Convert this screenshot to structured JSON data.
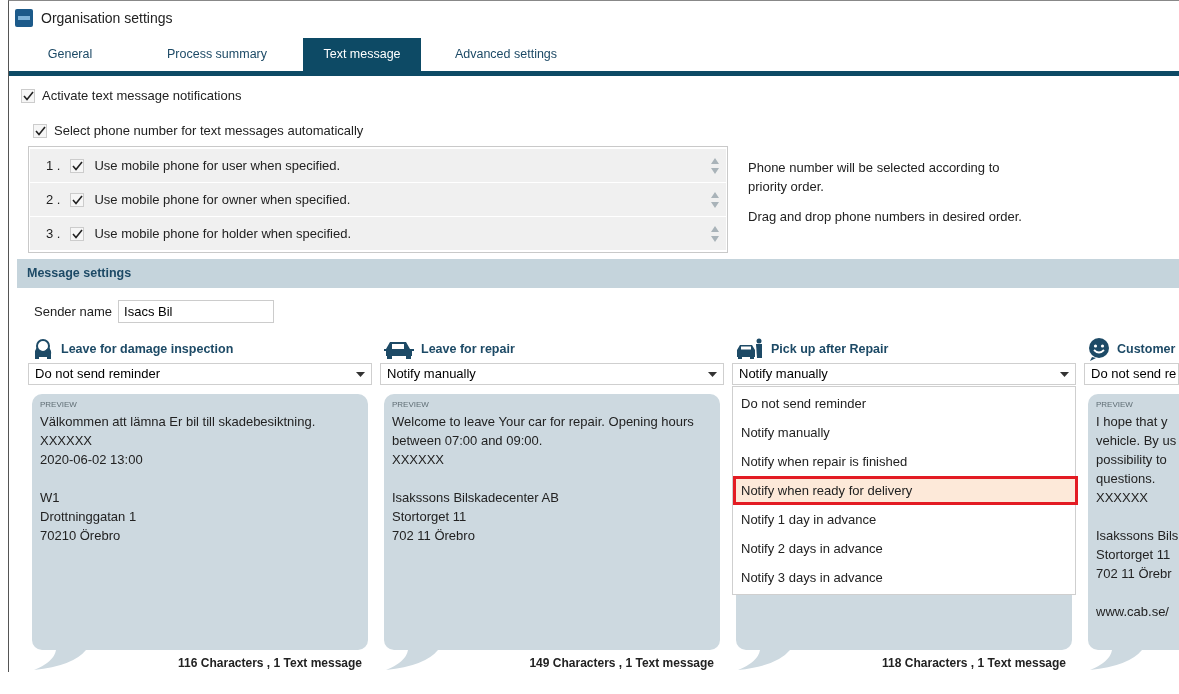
{
  "window": {
    "title": "Organisation settings"
  },
  "tabs": [
    {
      "label": "General",
      "selected": false
    },
    {
      "label": "Process summary",
      "selected": false
    },
    {
      "label": "Text message",
      "selected": true
    },
    {
      "label": "Advanced settings",
      "selected": false
    }
  ],
  "activate_notifications": {
    "label": "Activate text message notifications",
    "checked": true
  },
  "auto_phone": {
    "label": "Select phone number for text messages automatically",
    "checked": true
  },
  "phone_priorities": [
    {
      "number": "1 .",
      "label": "Use mobile phone for user when specified.",
      "checked": true
    },
    {
      "number": "2 .",
      "label": "Use mobile phone for owner when specified.",
      "checked": true
    },
    {
      "number": "3 .",
      "label": "Use mobile phone for holder when specified.",
      "checked": true
    }
  ],
  "priority_help": [
    "Phone number will be selected according to priority order.",
    "Drag and drop phone numbers in desired order."
  ],
  "message_settings": {
    "title": "Message settings",
    "sender_name": {
      "label": "Sender name",
      "value": "Isacs Bil"
    },
    "columns": [
      {
        "kind": "inspection",
        "title": "Leave for damage inspection",
        "reminder": "Do not send reminder",
        "preview_label": "PREVIEW",
        "preview": [
          [
            "Välkommen att lämna Er bil till skadebesiktning.",
            "XXXXXX",
            "2020-06-02 13:00"
          ],
          [
            "W1",
            "Drottninggatan 1",
            "70210 Örebro"
          ]
        ],
        "counter": "116 Characters , 1 Text message"
      },
      {
        "kind": "repair",
        "title": "Leave for repair",
        "reminder": "Notify manually",
        "preview_label": "PREVIEW",
        "preview": [
          [
            "Welcome to leave Your car for repair. Opening hours between 07:00 and 09:00.",
            "XXXXXX"
          ],
          [
            "Isakssons Bilskadecenter AB",
            "Stortorget 11",
            "702 11 Örebro"
          ]
        ],
        "counter": "149 Characters , 1 Text message"
      },
      {
        "kind": "pickup",
        "title": "Pick up after Repair",
        "reminder": "Notify manually",
        "counter": "118 Characters , 1 Text message",
        "open": true,
        "options": [
          {
            "label": "Do not send reminder",
            "highlighted": false
          },
          {
            "label": "Notify manually",
            "highlighted": false
          },
          {
            "label": "Notify when repair is finished",
            "highlighted": false
          },
          {
            "label": "Notify when ready for delivery",
            "highlighted": true
          },
          {
            "label": "Notify 1 day in advance",
            "highlighted": false
          },
          {
            "label": "Notify 2 days in advance",
            "highlighted": false
          },
          {
            "label": "Notify 3 days in advance",
            "highlighted": false
          }
        ]
      },
      {
        "kind": "feedback",
        "title": "Customer",
        "reminder": "Do not send re",
        "preview_label": "PREVIEW",
        "preview": [
          [
            "I hope that y",
            "vehicle. By us",
            "possibility to",
            "questions.",
            "XXXXXX"
          ],
          [
            "Isakssons Bils",
            "Stortorget 11",
            "702 11 Örebr"
          ],
          [
            "www.cab.se/"
          ]
        ]
      }
    ]
  }
}
